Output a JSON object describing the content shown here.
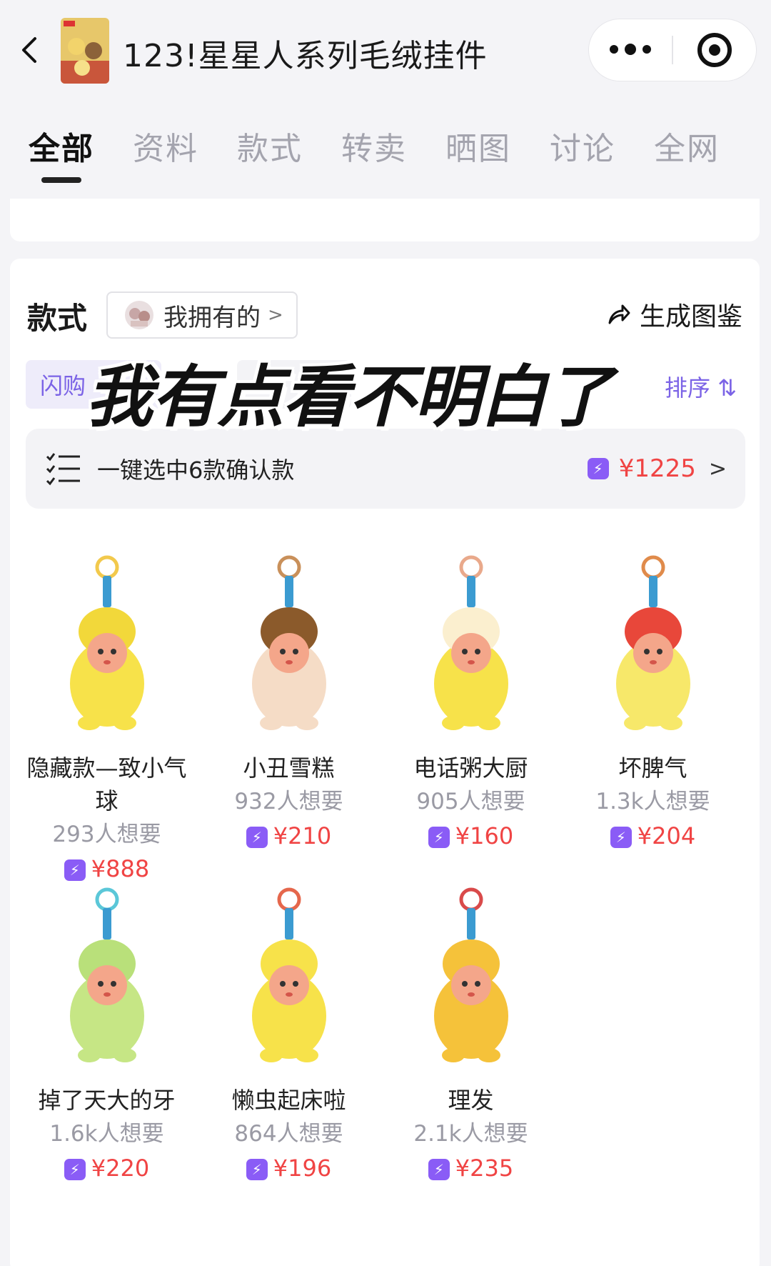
{
  "header": {
    "title": "123!星星人系列毛绒挂件"
  },
  "tabs": [
    {
      "label": "全部",
      "active": true
    },
    {
      "label": "资料",
      "active": false
    },
    {
      "label": "款式",
      "active": false
    },
    {
      "label": "转卖",
      "active": false
    },
    {
      "label": "晒图",
      "active": false
    },
    {
      "label": "讨论",
      "active": false
    },
    {
      "label": "全网",
      "active": false
    }
  ],
  "section": {
    "title": "款式",
    "owned_label": "我拥有的",
    "generate_label": "生成图鉴"
  },
  "filters": {
    "chip_label": "闪购",
    "sort_label": "排序"
  },
  "overlay_caption": "我有点看不明白了",
  "confirm": {
    "label": "一键选中6款确认款",
    "price": "¥1225"
  },
  "products": [
    {
      "name": "隐藏款—致小气球",
      "want": "293人想要",
      "price": "¥888",
      "hat_color": "#f2d83a",
      "body_color": "#f7e24a",
      "ring_color": "#f2c94c"
    },
    {
      "name": "小丑雪糕",
      "want": "932人想要",
      "price": "¥210",
      "hat_color": "#8b5a2b",
      "body_color": "#f5dcc6",
      "ring_color": "#c9905a"
    },
    {
      "name": "电话粥大厨",
      "want": "905人想要",
      "price": "¥160",
      "hat_color": "#fbefcf",
      "body_color": "#f7e24a",
      "ring_color": "#e9a98b"
    },
    {
      "name": "坏脾气",
      "want": "1.3k人想要",
      "price": "¥204",
      "hat_color": "#e8473a",
      "body_color": "#f7e86a",
      "ring_color": "#e08b4b"
    },
    {
      "name": "掉了天大的牙",
      "want": "1.6k人想要",
      "price": "¥220",
      "hat_color": "#b9e07a",
      "body_color": "#c6e685",
      "ring_color": "#5bc7d8"
    },
    {
      "name": "懒虫起床啦",
      "want": "864人想要",
      "price": "¥196",
      "hat_color": "#f7e24a",
      "body_color": "#f7e24a",
      "ring_color": "#e5674c"
    },
    {
      "name": "理发",
      "want": "2.1k人想要",
      "price": "¥235",
      "hat_color": "#f5c23a",
      "body_color": "#f5c23a",
      "ring_color": "#d94a4a"
    }
  ],
  "colors": {
    "accent_purple": "#7b63e6",
    "price_red": "#f04444"
  }
}
